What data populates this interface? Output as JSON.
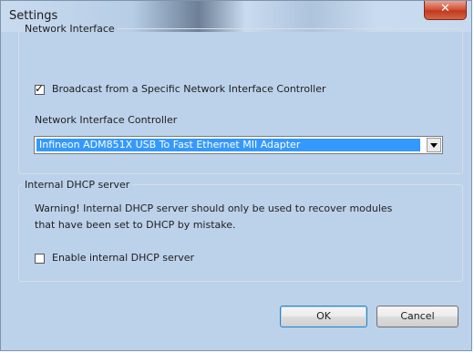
{
  "window": {
    "title": "Settings",
    "close_glyph": "✕"
  },
  "network_interface": {
    "legend": "Network Interface",
    "broadcast_label": "Broadcast from a Specific Network Interface Controller",
    "broadcast_checked": true,
    "controller_label": "Network Interface Controller",
    "controller_selected": "Infineon ADM851X USB To Fast Ethernet MII Adapter"
  },
  "dhcp": {
    "legend": "Internal DHCP server",
    "warning_line1": "Warning! Internal DHCP server should only be used to recover modules",
    "warning_line2": "that have been set to DHCP by mistake.",
    "enable_label": "Enable internal DHCP server",
    "enable_checked": false
  },
  "buttons": {
    "ok": "OK",
    "cancel": "Cancel"
  },
  "icons": {
    "close": "close-icon",
    "dropdown": "chevron-down-icon",
    "check": "check-icon"
  }
}
